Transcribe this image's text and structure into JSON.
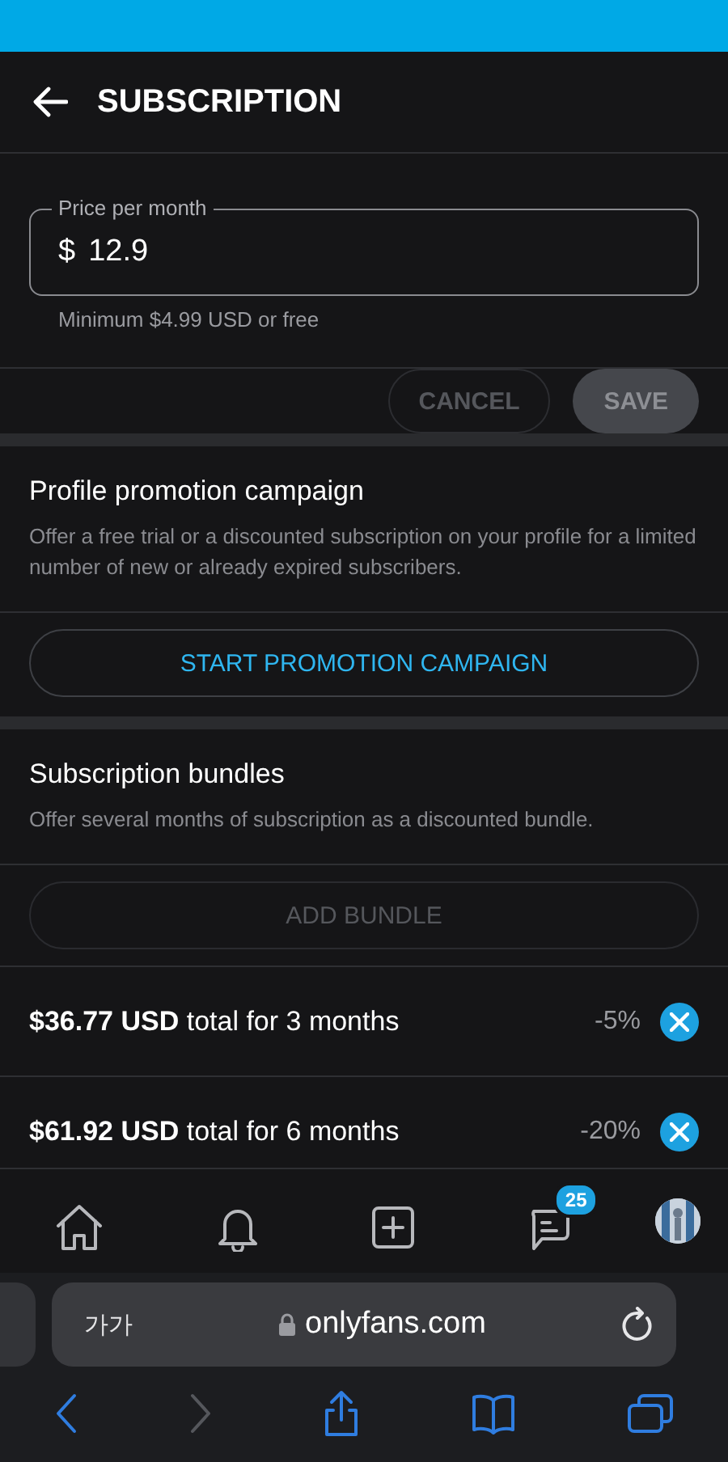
{
  "header": {
    "title": "SUBSCRIPTION"
  },
  "price": {
    "label": "Price per month",
    "currency": "$",
    "value": "12.9",
    "hint": "Minimum $4.99 USD or free"
  },
  "actions": [
    {
      "label": "CANCEL",
      "kind": "outline",
      "disabled": true
    },
    {
      "label": "SAVE",
      "kind": "filled",
      "disabled": true
    }
  ],
  "promotion": {
    "title": "Profile promotion campaign",
    "description": "Offer a free trial or a discounted subscription on your profile for a limited number of new or already expired subscribers.",
    "button": {
      "label": "START PROMOTION CAMPAIGN",
      "disabled": false
    }
  },
  "bundles": {
    "title": "Subscription bundles",
    "description": "Offer several months of subscription as a discounted bundle.",
    "button": {
      "label": "ADD BUNDLE",
      "disabled": true
    },
    "items": [
      {
        "text": "**$36.77 USD** total for 3 months",
        "discount": "-5%"
      },
      {
        "text": "**$61.92 USD** total for 6 months",
        "discount": "-20%"
      }
    ]
  },
  "nav": {
    "items": [
      {
        "kind": "home"
      },
      {
        "kind": "bell"
      },
      {
        "kind": "plus"
      },
      {
        "kind": "chat",
        "badge": "25"
      },
      {
        "kind": "avatar"
      }
    ]
  },
  "browser": {
    "text_size": "가가",
    "url": "onlyfans.com",
    "toolbar": [
      {
        "kind": "back",
        "disabled": false
      },
      {
        "kind": "forward",
        "disabled": true
      },
      {
        "kind": "share",
        "disabled": false
      },
      {
        "kind": "book",
        "disabled": false
      },
      {
        "kind": "tabs",
        "disabled": false
      }
    ]
  }
}
